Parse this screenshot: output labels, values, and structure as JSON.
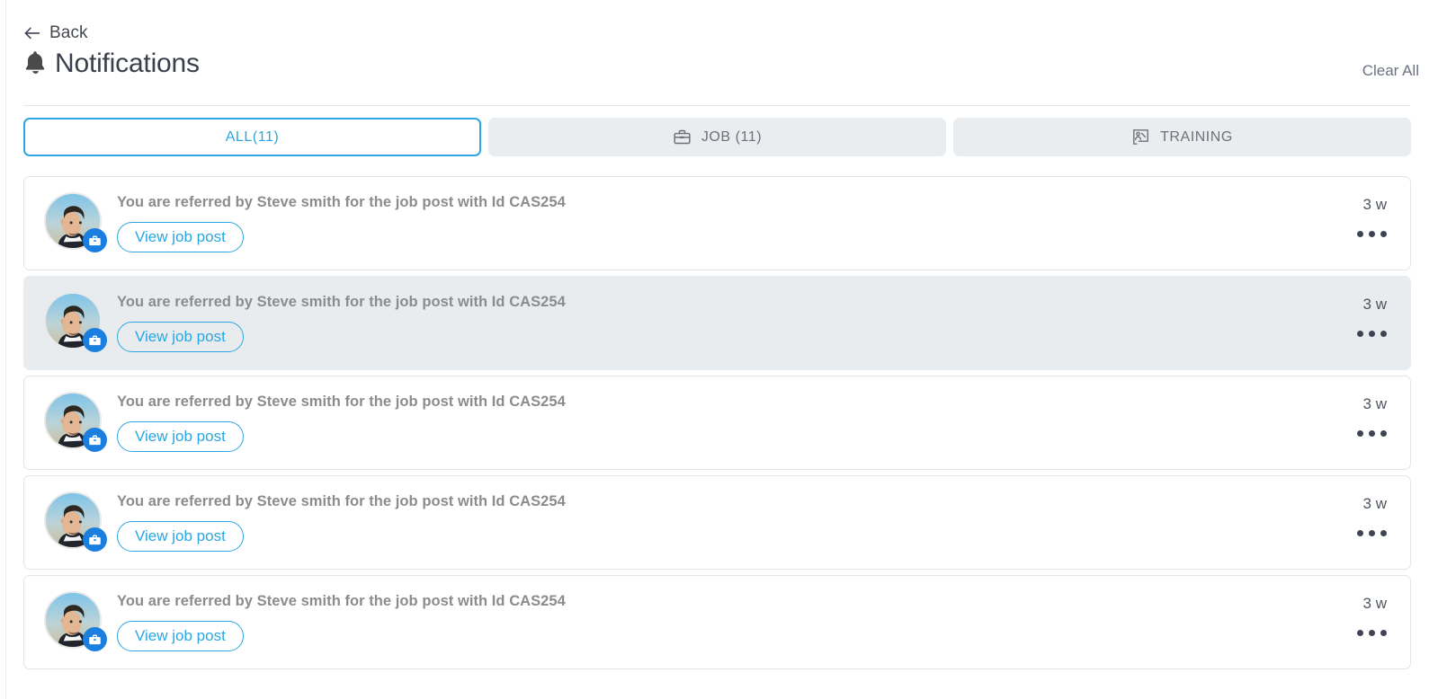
{
  "header": {
    "back_label": "Back",
    "back_icon": "arrow-left-icon",
    "title": "Notifications",
    "title_icon": "bell-icon",
    "clear_all_label": "Clear All"
  },
  "tabs": [
    {
      "label": "ALL(11)",
      "icon": null,
      "active": true
    },
    {
      "label": "JOB (11)",
      "icon": "briefcase-icon",
      "active": false
    },
    {
      "label": "TRAINING",
      "icon": "training-board-icon",
      "active": false
    }
  ],
  "notifications": [
    {
      "message": "You are referred by Steve smith for the job post with Id CAS254",
      "action_label": "View job post",
      "time": "3 w",
      "badge_icon": "briefcase-icon",
      "avatar_icon": "user-avatar",
      "unread": false
    },
    {
      "message": "You are referred by Steve smith for the job post with Id CAS254",
      "action_label": "View job post",
      "time": "3 w",
      "badge_icon": "briefcase-icon",
      "avatar_icon": "user-avatar",
      "unread": true
    },
    {
      "message": "You are referred by Steve smith for the job post with Id CAS254",
      "action_label": "View job post",
      "time": "3 w",
      "badge_icon": "briefcase-icon",
      "avatar_icon": "user-avatar",
      "unread": false
    },
    {
      "message": "You are referred by Steve smith for the job post with Id CAS254",
      "action_label": "View job post",
      "time": "3 w",
      "badge_icon": "briefcase-icon",
      "avatar_icon": "user-avatar",
      "unread": false
    },
    {
      "message": "You are referred by Steve smith for the job post with Id CAS254",
      "action_label": "View job post",
      "time": "3 w",
      "badge_icon": "briefcase-icon",
      "avatar_icon": "user-avatar",
      "unread": false
    }
  ],
  "colors": {
    "accent": "#2ba6e0",
    "badge_blue": "#1b7fe0",
    "unread_bg": "#e8ecef",
    "tab_inactive_bg": "#e9edf0",
    "text_muted": "#8b8c8e",
    "title": "#3a3f4b"
  }
}
